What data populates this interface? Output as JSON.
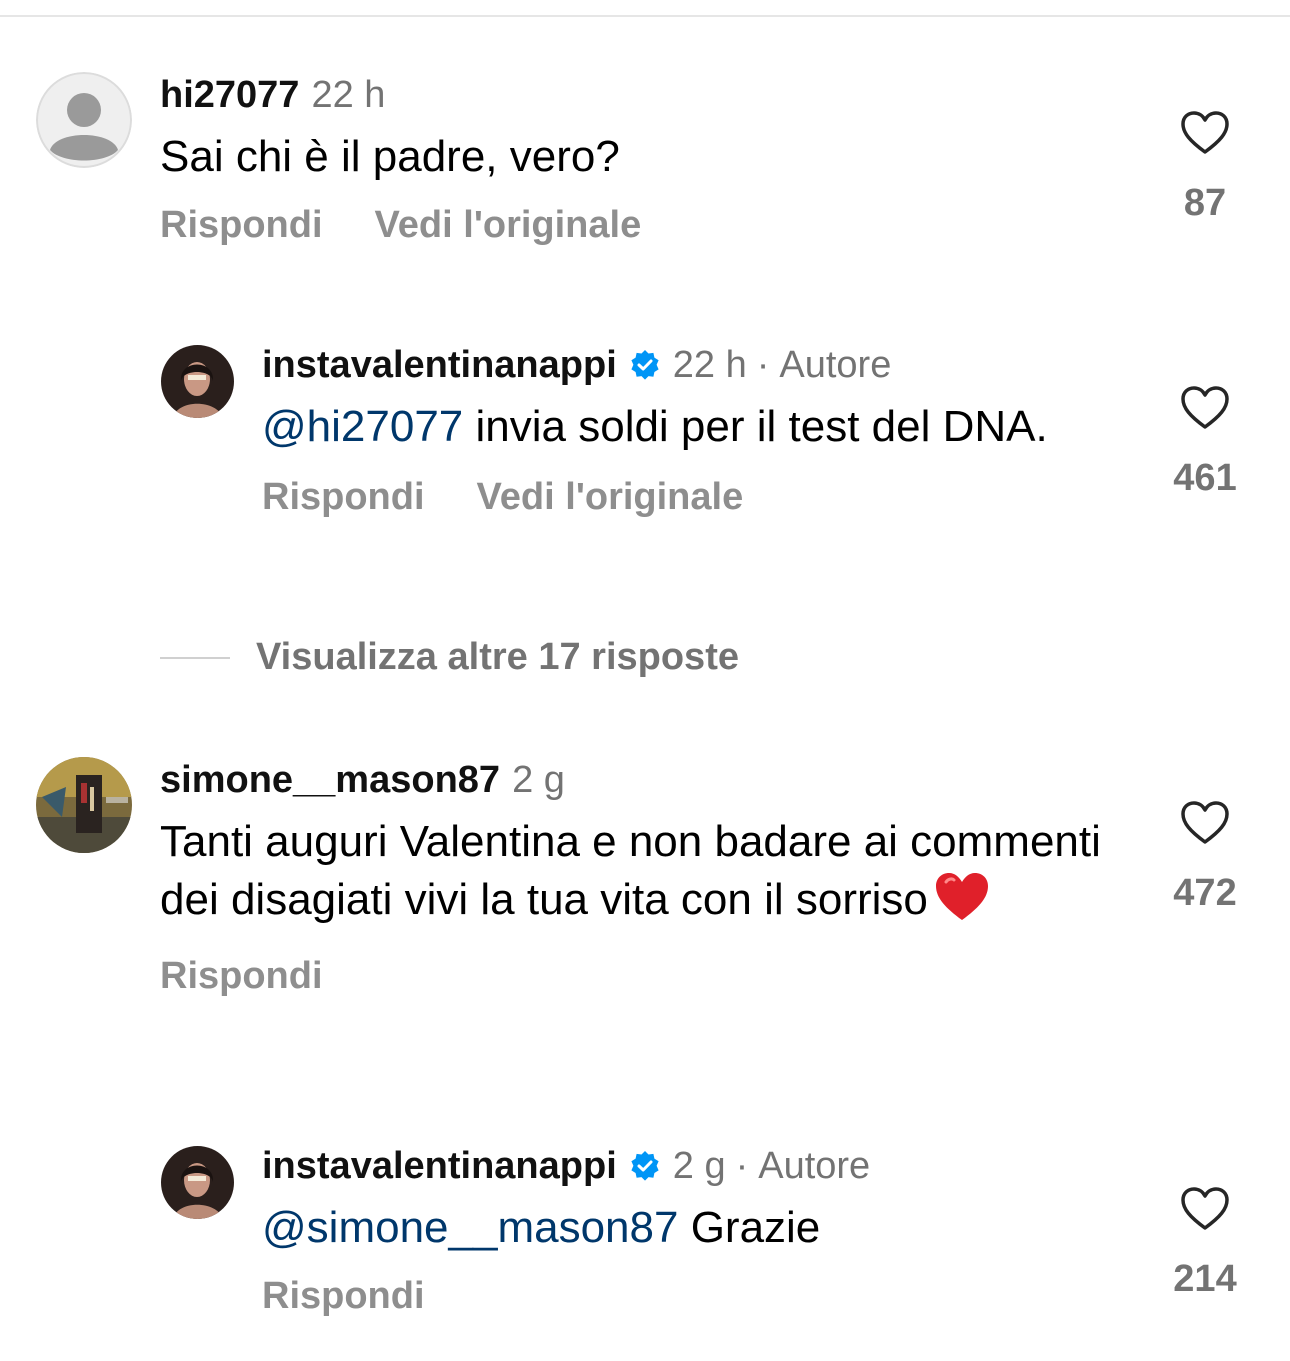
{
  "comments": [
    {
      "username": "hi27077",
      "time": "22 h",
      "text": "Sai chi è il padre, vero?",
      "reply_label": "Rispondi",
      "see_original_label": "Vedi l'originale",
      "likes": "87"
    },
    {
      "username": "instavalentinanappi",
      "time": "22 h",
      "dot": "·",
      "author_label": "Autore",
      "mention": "@hi27077",
      "text": "invia soldi per il test del DNA.",
      "reply_label": "Rispondi",
      "see_original_label": "Vedi l'originale",
      "likes": "461"
    },
    {
      "username": "simone__mason87",
      "time": "2 g",
      "text": "Tanti auguri Valentina e non badare ai commenti dei disagiati  vivi la tua vita con il sorriso",
      "reply_label": "Rispondi",
      "likes": "472"
    },
    {
      "username": "instavalentinanappi",
      "time": "2 g",
      "dot": "·",
      "author_label": "Autore",
      "mention": "@simone__mason87",
      "text": "Grazie",
      "reply_label": "Rispondi",
      "likes": "214"
    }
  ],
  "view_more_replies": "Visualizza altre 17 risposte",
  "icons": {
    "like": "heart-outline-icon",
    "verified": "verified-badge-icon",
    "emoji": "red-heart-emoji"
  },
  "colors": {
    "mention": "#00376b",
    "verified": "#0095f6",
    "secondary_text": "#737373",
    "action_text": "#8e8e8e"
  }
}
